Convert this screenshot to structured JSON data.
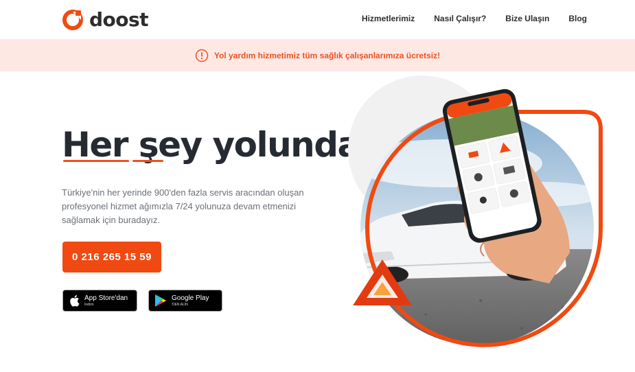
{
  "brand": {
    "name": "doost",
    "color": "#f04a12"
  },
  "nav": {
    "items": [
      {
        "label": "Hizmetlerimiz"
      },
      {
        "label": "Nasıl Çalışır?"
      },
      {
        "label": "Bize Ulaşın"
      },
      {
        "label": "Blog"
      }
    ]
  },
  "banner": {
    "icon": "info-icon",
    "text": "Yol yardım hizmetimiz tüm sağlık çalışanlarımıza ücretsiz!"
  },
  "hero": {
    "title": "Her şey yolunda",
    "description": "Türkiye'nin her yerinde 900'den fazla servis aracından oluşan profesyonel hizmet ağımızla 7/24 yolunuza devam etmenizi sağlamak için buradayız.",
    "phone_button": "0 216 265 15 59"
  },
  "stores": {
    "apple": {
      "main": "App Store'dan",
      "sub": "İndirin",
      "icon": "apple-icon"
    },
    "google": {
      "main": "Google Play",
      "sub": "'DEN ALIN",
      "icon": "google-play-icon"
    }
  }
}
